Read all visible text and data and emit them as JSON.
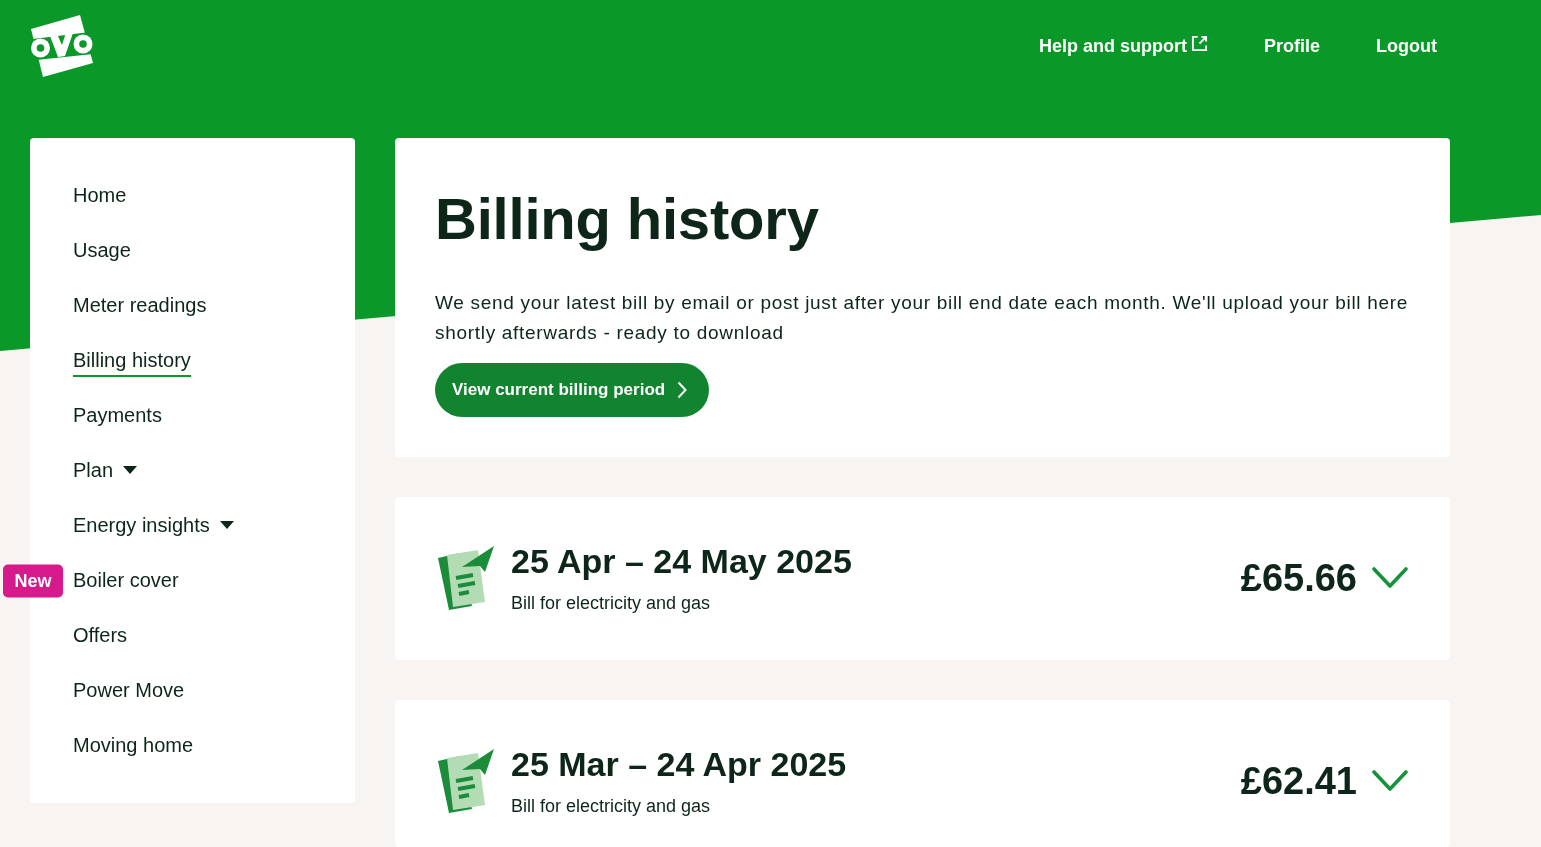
{
  "header": {
    "nav_links": [
      {
        "label": "Help and support",
        "external": true
      },
      {
        "label": "Profile",
        "external": false
      },
      {
        "label": "Logout",
        "external": false
      }
    ]
  },
  "sidebar": {
    "items": [
      {
        "label": "Home",
        "kind": "link",
        "selected": false
      },
      {
        "label": "Usage",
        "kind": "link",
        "selected": false
      },
      {
        "label": "Meter readings",
        "kind": "link",
        "selected": false
      },
      {
        "label": "Billing history",
        "kind": "link",
        "selected": true
      },
      {
        "label": "Payments",
        "kind": "link",
        "selected": false
      },
      {
        "label": "Plan",
        "kind": "menu",
        "selected": false
      },
      {
        "label": "Energy insights",
        "kind": "menu",
        "selected": false
      },
      {
        "label": "Boiler cover",
        "kind": "link",
        "selected": false,
        "badge": "New"
      },
      {
        "label": "Offers",
        "kind": "link",
        "selected": false
      },
      {
        "label": "Power Move",
        "kind": "link",
        "selected": false
      },
      {
        "label": "Moving home",
        "kind": "link",
        "selected": false
      }
    ]
  },
  "intro": {
    "title": "Billing history",
    "description": "We send your latest bill by email or post just after your bill end date each month. We'll upload your bill here shortly afterwards - ready to download",
    "button": "View current billing period"
  },
  "bills": [
    {
      "period": "25 Apr – 24 May 2025",
      "description": "Bill for electricity and gas",
      "amount": "£65.66",
      "expanded": false
    },
    {
      "period": "25 Mar – 24 Apr 2025",
      "description": "Bill for electricity and gas",
      "amount": "£62.41",
      "expanded": false
    }
  ]
}
